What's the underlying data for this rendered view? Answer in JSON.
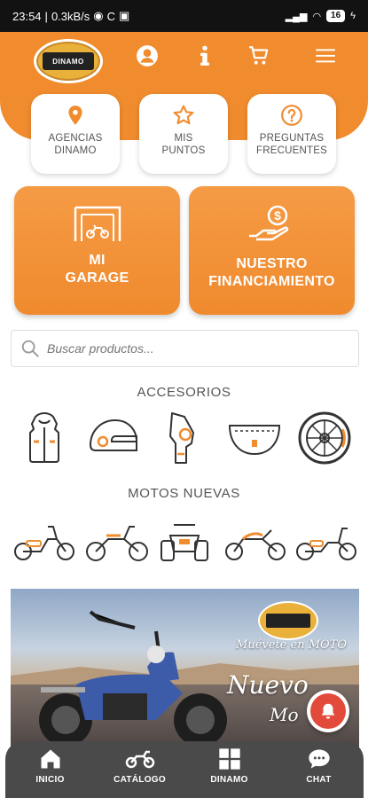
{
  "status_bar": {
    "time": "23:54",
    "speed": "0.3kB/s",
    "battery": "16"
  },
  "header": {
    "logo_text": "DINAMO",
    "icons": [
      "user-icon",
      "info-icon",
      "cart-icon",
      "menu-icon"
    ]
  },
  "quick_actions": [
    {
      "label": "AGENCIAS\nDINAMO",
      "icon": "location-pin-icon"
    },
    {
      "label": "MIS\nPUNTOS",
      "icon": "star-icon"
    },
    {
      "label": "PREGUNTAS\nFRECUENTES",
      "icon": "question-icon"
    }
  ],
  "big_buttons": [
    {
      "label": "MI\nGARAGE",
      "icon": "garage-icon"
    },
    {
      "label": "NUESTRO\nFINANCIAMIENTO",
      "icon": "money-hand-icon"
    }
  ],
  "search": {
    "placeholder": "Buscar productos..."
  },
  "accessories": {
    "title": "ACCESORIOS",
    "items": [
      "jacket-icon",
      "helmet-icon",
      "knee-guard-icon",
      "seat-icon",
      "tire-icon"
    ]
  },
  "new_motos": {
    "title": "MOTOS NUEVAS",
    "items": [
      "scooter-icon",
      "dirtbike-icon",
      "atv-icon",
      "sportbike-icon",
      "cruiser-icon"
    ]
  },
  "banner": {
    "logo_text": "DINAMO",
    "slogan": "Muévete en MOTO",
    "headline": "Nuevo",
    "subheadline": "Mo"
  },
  "tabbar": [
    {
      "label": "INICIO",
      "icon": "home-icon"
    },
    {
      "label": "CATÁLOGO",
      "icon": "motorcycle-icon"
    },
    {
      "label": "DINAMO",
      "icon": "grid-icon"
    },
    {
      "label": "CHAT",
      "icon": "chat-icon"
    }
  ],
  "colors": {
    "brand_orange": "#f08c2e",
    "tab_bar": "#4a4a4a",
    "notification_red": "#e24a3b"
  }
}
